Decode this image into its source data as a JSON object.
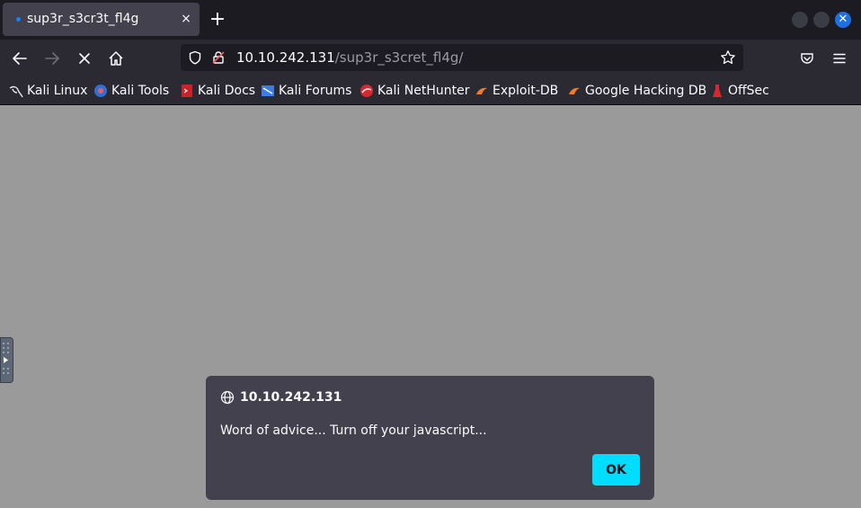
{
  "tab": {
    "title": "sup3r_s3cr3t_fl4g",
    "close": "×"
  },
  "new_tab": "+",
  "url": {
    "host": "10.10.242.131",
    "path": "/sup3r_s3cret_fl4g/"
  },
  "bookmarks": [
    {
      "label": "Kali Linux",
      "icon": "kali-dragon-icon"
    },
    {
      "label": "Kali Tools",
      "icon": "kali-tools-icon"
    },
    {
      "label": "Kali Docs",
      "icon": "kali-docs-icon"
    },
    {
      "label": "Kali Forums",
      "icon": "kali-forums-icon"
    },
    {
      "label": "Kali NetHunter",
      "icon": "nethunter-icon"
    },
    {
      "label": "Exploit-DB",
      "icon": "exploit-db-icon"
    },
    {
      "label": "Google Hacking DB",
      "icon": "ghdb-icon"
    },
    {
      "label": "OffSec",
      "icon": "offsec-icon"
    }
  ],
  "dialog": {
    "origin": "10.10.242.131",
    "message": "Word of advice... Turn off your javascript...",
    "ok_label": "OK"
  },
  "colors": {
    "accent": "#00ddff",
    "tab_dot": "#0a84ff",
    "window_close": "#1e6fe0"
  }
}
